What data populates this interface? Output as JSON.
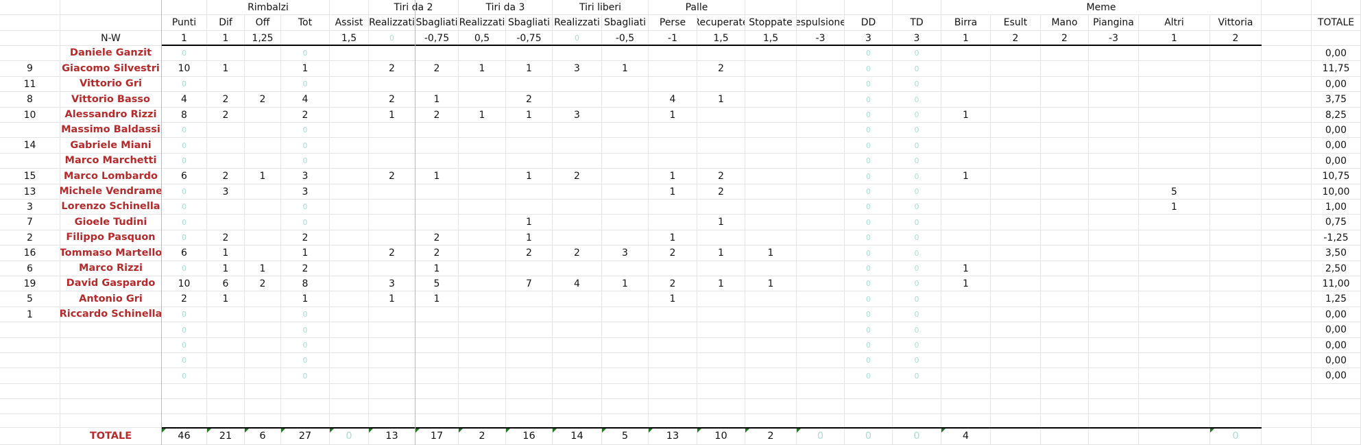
{
  "header": {
    "groups": [
      "Rimbalzi",
      "Tiri da 2",
      "Tiri da 3",
      "Tiri liberi",
      "Palle",
      "Meme"
    ],
    "columns": [
      "Punti",
      "Dif",
      "Off",
      "Tot",
      "Assist",
      "Realizzati",
      "Sbagliati",
      "Realizzati",
      "Sbagliati",
      "Realizzati",
      "Sbagliati",
      "Perse",
      "Recuperate",
      "Stoppate",
      "espulsione",
      "DD",
      "TD",
      "Birra",
      "Esult",
      "Mano",
      "Piangina",
      "Altri",
      "Vittoria"
    ],
    "total_label": "TOTALE"
  },
  "weights": {
    "label": "N-W",
    "values": [
      "1",
      "1",
      "1,25",
      "",
      "1,5",
      "0",
      "-0,75",
      "0,5",
      "-0,75",
      "0",
      "-0,5",
      "-1",
      "1,5",
      "1,5",
      "-3",
      "3",
      "3",
      "1",
      "2",
      "2",
      "-3",
      "1",
      "2"
    ]
  },
  "players": [
    {
      "num": "",
      "name": "Daniele Ganzit",
      "cells": [
        "0",
        "",
        "",
        "0",
        "",
        "",
        "",
        "",
        "",
        "",
        "",
        "",
        "",
        "",
        "",
        "0",
        "0",
        "",
        "",
        "",
        "",
        "",
        ""
      ],
      "total": "0,00"
    },
    {
      "num": "9",
      "name": "Giacomo Silvestri",
      "cells": [
        "10",
        "1",
        "",
        "1",
        "",
        "2",
        "2",
        "1",
        "1",
        "3",
        "1",
        "",
        "2",
        "",
        "",
        "0",
        "0",
        "",
        "",
        "",
        "",
        "",
        ""
      ],
      "total": "11,75"
    },
    {
      "num": "11",
      "name": "Vittorio Gri",
      "cells": [
        "0",
        "",
        "",
        "0",
        "",
        "",
        "",
        "",
        "",
        "",
        "",
        "",
        "",
        "",
        "",
        "0",
        "0",
        "",
        "",
        "",
        "",
        "",
        ""
      ],
      "total": "0,00"
    },
    {
      "num": "8",
      "name": "Vittorio Basso",
      "cells": [
        "4",
        "2",
        "2",
        "4",
        "",
        "2",
        "1",
        "",
        "2",
        "",
        "",
        "4",
        "1",
        "",
        "",
        "0",
        "0",
        "",
        "",
        "",
        "",
        "",
        ""
      ],
      "total": "3,75"
    },
    {
      "num": "10",
      "name": "Alessandro Rizzi",
      "cells": [
        "8",
        "2",
        "",
        "2",
        "",
        "1",
        "2",
        "1",
        "1",
        "3",
        "",
        "1",
        "",
        "",
        "",
        "0",
        "0",
        "1",
        "",
        "",
        "",
        "",
        ""
      ],
      "total": "8,25"
    },
    {
      "num": "",
      "name": "Massimo Baldassi",
      "cells": [
        "0",
        "",
        "",
        "0",
        "",
        "",
        "",
        "",
        "",
        "",
        "",
        "",
        "",
        "",
        "",
        "0",
        "0",
        "",
        "",
        "",
        "",
        "",
        ""
      ],
      "total": "0,00"
    },
    {
      "num": "14",
      "name": "Gabriele Miani",
      "cells": [
        "0",
        "",
        "",
        "0",
        "",
        "",
        "",
        "",
        "",
        "",
        "",
        "",
        "",
        "",
        "",
        "0",
        "0",
        "",
        "",
        "",
        "",
        "",
        ""
      ],
      "total": "0,00"
    },
    {
      "num": "",
      "name": "Marco Marchetti",
      "cells": [
        "0",
        "",
        "",
        "0",
        "",
        "",
        "",
        "",
        "",
        "",
        "",
        "",
        "",
        "",
        "",
        "0",
        "0",
        "",
        "",
        "",
        "",
        "",
        ""
      ],
      "total": "0,00"
    },
    {
      "num": "15",
      "name": "Marco Lombardo",
      "cells": [
        "6",
        "2",
        "1",
        "3",
        "",
        "2",
        "1",
        "",
        "1",
        "2",
        "",
        "1",
        "2",
        "",
        "",
        "0",
        "0",
        "1",
        "",
        "",
        "",
        "",
        ""
      ],
      "total": "10,75"
    },
    {
      "num": "13",
      "name": "Michele Vendrame",
      "cells": [
        "0",
        "3",
        "",
        "3",
        "",
        "",
        "",
        "",
        "",
        "",
        "",
        "1",
        "2",
        "",
        "",
        "0",
        "0",
        "",
        "",
        "",
        "",
        "5",
        ""
      ],
      "total": "10,00"
    },
    {
      "num": "3",
      "name": "Lorenzo Schinella",
      "cells": [
        "0",
        "",
        "",
        "0",
        "",
        "",
        "",
        "",
        "",
        "",
        "",
        "",
        "",
        "",
        "",
        "0",
        "0",
        "",
        "",
        "",
        "",
        "1",
        ""
      ],
      "total": "1,00"
    },
    {
      "num": "7",
      "name": "Gioele Tudini",
      "cells": [
        "0",
        "",
        "",
        "0",
        "",
        "",
        "",
        "",
        "1",
        "",
        "",
        "",
        "1",
        "",
        "",
        "0",
        "0",
        "",
        "",
        "",
        "",
        "",
        ""
      ],
      "total": "0,75"
    },
    {
      "num": "2",
      "name": "Filippo Pasquon",
      "cells": [
        "0",
        "2",
        "",
        "2",
        "",
        "",
        "2",
        "",
        "1",
        "",
        "",
        "1",
        "",
        "",
        "",
        "0",
        "0",
        "",
        "",
        "",
        "",
        "",
        ""
      ],
      "total": "-1,25"
    },
    {
      "num": "16",
      "name": "Tommaso Martello",
      "cells": [
        "6",
        "1",
        "",
        "1",
        "",
        "2",
        "2",
        "",
        "2",
        "2",
        "3",
        "2",
        "1",
        "1",
        "",
        "0",
        "0",
        "",
        "",
        "",
        "",
        "",
        ""
      ],
      "total": "3,50"
    },
    {
      "num": "6",
      "name": "Marco Rizzi",
      "cells": [
        "0",
        "1",
        "1",
        "2",
        "",
        "",
        "1",
        "",
        "",
        "",
        "",
        "",
        "",
        "",
        "",
        "0",
        "0",
        "1",
        "",
        "",
        "",
        "",
        ""
      ],
      "total": "2,50"
    },
    {
      "num": "19",
      "name": "David Gaspardo",
      "cells": [
        "10",
        "6",
        "2",
        "8",
        "",
        "3",
        "5",
        "",
        "7",
        "4",
        "1",
        "2",
        "1",
        "1",
        "",
        "0",
        "0",
        "1",
        "",
        "",
        "",
        "",
        ""
      ],
      "total": "11,00"
    },
    {
      "num": "5",
      "name": "Antonio Gri",
      "cells": [
        "2",
        "1",
        "",
        "1",
        "",
        "1",
        "1",
        "",
        "",
        "",
        "",
        "1",
        "",
        "",
        "",
        "0",
        "0",
        "",
        "",
        "",
        "",
        "",
        ""
      ],
      "total": "1,25"
    },
    {
      "num": "1",
      "name": "Riccardo Schinella",
      "cells": [
        "0",
        "",
        "",
        "0",
        "",
        "",
        "",
        "",
        "",
        "",
        "",
        "",
        "",
        "",
        "",
        "0",
        "0",
        "",
        "",
        "",
        "",
        "",
        ""
      ],
      "total": "0,00"
    },
    {
      "num": "",
      "name": "",
      "cells": [
        "0",
        "",
        "",
        "0",
        "",
        "",
        "",
        "",
        "",
        "",
        "",
        "",
        "",
        "",
        "",
        "0",
        "0",
        "",
        "",
        "",
        "",
        "",
        ""
      ],
      "total": "0,00"
    },
    {
      "num": "",
      "name": "",
      "cells": [
        "0",
        "",
        "",
        "0",
        "",
        "",
        "",
        "",
        "",
        "",
        "",
        "",
        "",
        "",
        "",
        "0",
        "0",
        "",
        "",
        "",
        "",
        "",
        ""
      ],
      "total": "0,00"
    },
    {
      "num": "",
      "name": "",
      "cells": [
        "0",
        "",
        "",
        "0",
        "",
        "",
        "",
        "",
        "",
        "",
        "",
        "",
        "",
        "",
        "",
        "0",
        "0",
        "",
        "",
        "",
        "",
        "",
        ""
      ],
      "total": "0,00"
    },
    {
      "num": "",
      "name": "",
      "cells": [
        "0",
        "",
        "",
        "0",
        "",
        "",
        "",
        "",
        "",
        "",
        "",
        "",
        "",
        "",
        "",
        "0",
        "0",
        "",
        "",
        "",
        "",
        "",
        ""
      ],
      "total": "0,00"
    }
  ],
  "totals": {
    "label": "TOTALE",
    "values": [
      "46",
      "21",
      "6",
      "27",
      "0",
      "13",
      "17",
      "2",
      "16",
      "14",
      "5",
      "13",
      "10",
      "2",
      "0",
      "0",
      "0",
      "4",
      "",
      "",
      "",
      "",
      "0"
    ]
  },
  "colors": {
    "player_name": "#b52a2a",
    "zero_value": "#a8dcd3",
    "gridline": "#e3e3e3",
    "header_rule": "#000000",
    "comment_marker": "#1d7a1d"
  }
}
